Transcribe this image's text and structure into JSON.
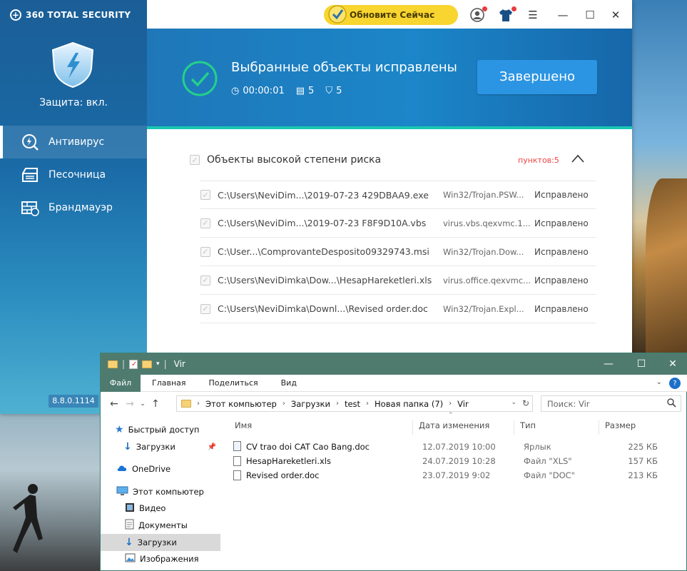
{
  "antivirus": {
    "brand": "360 TOTAL SECURITY",
    "protection": "Защита: вкл.",
    "nav": [
      {
        "label": "Антивирус"
      },
      {
        "label": "Песочница"
      },
      {
        "label": "Брандмауэр"
      }
    ],
    "version": "8.8.0.1114",
    "update_label": "Обновите Сейчас",
    "header_title": "Выбранные объекты исправлены",
    "stats": {
      "time": "00:00:01",
      "items": "5",
      "fixed": "5"
    },
    "done_label": "Завершено",
    "group_title": "Объекты высокой степени риска",
    "group_count": "пунктов:5",
    "threats": [
      {
        "path": "C:\\Users\\NeviDim...\\2019-07-23 429DBAA9.exe",
        "threat": "Win32/Trojan.PSW...",
        "status": "Исправлено"
      },
      {
        "path": "C:\\Users\\NeviDim...\\2019-07-23 F8F9D10A.vbs",
        "threat": "virus.vbs.qexvmc.1...",
        "status": "Исправлено"
      },
      {
        "path": "C:\\User...\\ComprovanteDesposito09329743.msi",
        "threat": "Win32/Trojan.Dow...",
        "status": "Исправлено"
      },
      {
        "path": "C:\\Users\\NeviDimka\\Dow...\\HesapHareketleri.xls",
        "threat": "virus.office.qexvmc...",
        "status": "Исправлено"
      },
      {
        "path": "C:\\Users\\NeviDimka\\Downl...\\Revised order.doc",
        "threat": "Win32/Trojan.Expl...",
        "status": "Исправлено"
      }
    ]
  },
  "explorer": {
    "title": "Vir",
    "ribbon": [
      "Файл",
      "Главная",
      "Поделиться",
      "Вид"
    ],
    "breadcrumb": [
      "Этот компьютер",
      "Загрузки",
      "test",
      "Новая папка (7)",
      "Vir"
    ],
    "search_placeholder": "Поиск: Vir",
    "nav_items": [
      {
        "label": "Быстрый доступ"
      },
      {
        "label": "Загрузки"
      },
      {
        "label": "OneDrive"
      },
      {
        "label": "Этот компьютер"
      },
      {
        "label": "Видео"
      },
      {
        "label": "Документы"
      },
      {
        "label": "Загрузки"
      },
      {
        "label": "Изображения"
      }
    ],
    "columns": [
      "Имя",
      "Дата изменения",
      "Тип",
      "Размер"
    ],
    "files": [
      {
        "name": "CV trao doi CAT Cao Bang.doc",
        "date": "12.07.2019 10:00",
        "type": "Ярлык",
        "size": "225 КБ"
      },
      {
        "name": "HesapHareketleri.xls",
        "date": "24.07.2019 10:28",
        "type": "Файл \"XLS\"",
        "size": "157 КБ"
      },
      {
        "name": "Revised order.doc",
        "date": "23.07.2019 9:02",
        "type": "Файл \"DOC\"",
        "size": "213 КБ"
      }
    ]
  },
  "colors": {
    "accent": "#1f77b8",
    "update": "#f8d52f",
    "explorer_title": "#4f7b6f",
    "count_red": "#ee4444"
  }
}
